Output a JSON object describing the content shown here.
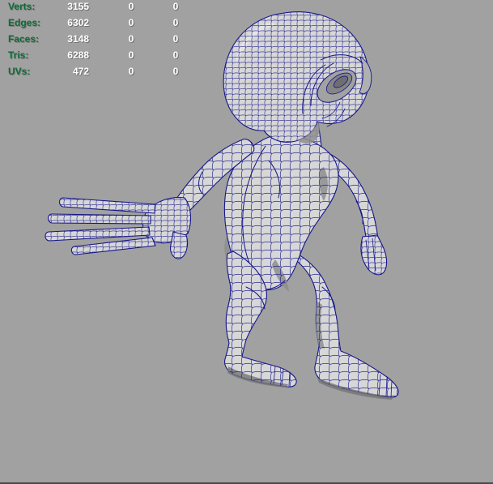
{
  "viewport": {
    "app": "3d-viewport",
    "background_color": "#a1a1a1",
    "bottom_edge_color": "#4a4a4a"
  },
  "hud": {
    "label_color": "#0d6b38",
    "value_color": "#ffffff",
    "rows": [
      {
        "label": "Verts:",
        "values": [
          "3155",
          "0",
          "0"
        ]
      },
      {
        "label": "Edges:",
        "values": [
          "6302",
          "0",
          "0"
        ]
      },
      {
        "label": "Faces:",
        "values": [
          "3148",
          "0",
          "0"
        ]
      },
      {
        "label": "Tris:",
        "values": [
          "6288",
          "0",
          "0"
        ]
      },
      {
        "label": "UVs:",
        "values": [
          "472",
          "0",
          "0"
        ]
      }
    ]
  },
  "model": {
    "description": "wireframe cartoon character, crouching, facing right",
    "wire_color": "#15158a",
    "surface_color": "#d7d7d7",
    "shadow_color": "#8e8e8e"
  }
}
